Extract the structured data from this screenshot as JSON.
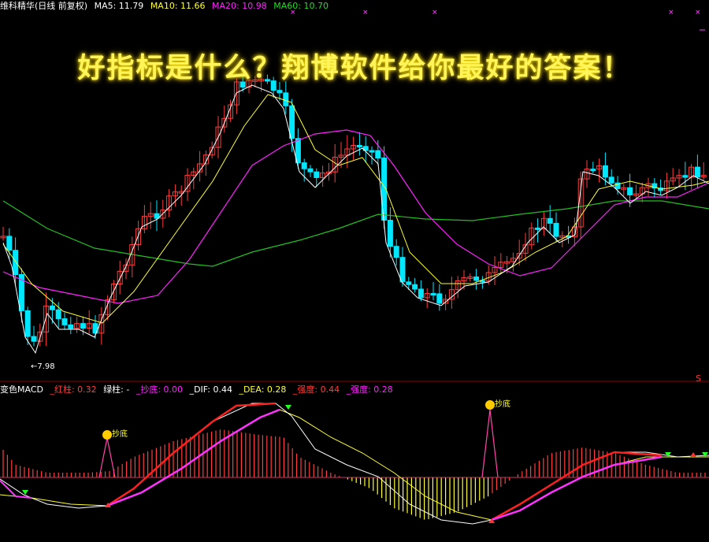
{
  "header": {
    "title": "维科精华(日线 前复权)",
    "ma5": "MA5: 11.79",
    "ma10": "MA10: 11.66",
    "ma20": "MA20: 10.98",
    "ma60": "MA60: 10.70"
  },
  "banner": "好指标是什么？翔博软件给你最好的答案！",
  "low_marker": "←7.98",
  "corner_mark": "S",
  "macd_header": {
    "name": "变色MACD",
    "red": "_红柱: 0.32",
    "green": "绿柱: -",
    "buy": "_抄底: 0.00",
    "dif": "_DIF: 0.44",
    "dea": "_DEA: 0.28",
    "strong1": "_强度: 0.44",
    "strong2": "_强度: 0.28"
  },
  "signal1": "抄底",
  "signal2": "抄底",
  "colors": {
    "up": "#ff3d3d",
    "down": "#00e8ff",
    "ma5": "#ffffff",
    "ma10": "#ffff33",
    "ma20": "#ff22ff",
    "ma60": "#22c022",
    "dif": "#ffffff",
    "dea": "#ffff33"
  }
}
